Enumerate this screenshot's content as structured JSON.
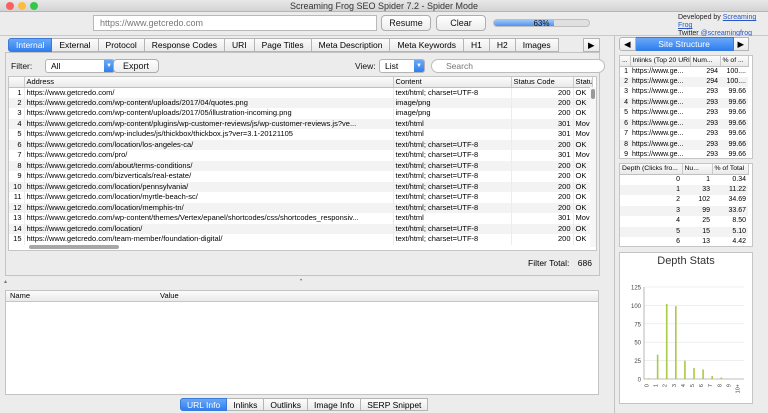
{
  "window": {
    "title": "Screaming Frog SEO Spider 7.2 - Spider Mode"
  },
  "toolbar": {
    "url_value": "https://www.getcredo.com",
    "resume_label": "Resume",
    "clear_label": "Clear",
    "progress_text": "63%",
    "progress_value": 0.63,
    "developed_by": "Developed by",
    "developer_link": "Screaming Frog",
    "twitter": "Twitter",
    "twitter_link": "@screamingfrog"
  },
  "main_tabs": [
    "Internal",
    "External",
    "Protocol",
    "Response Codes",
    "URI",
    "Page Titles",
    "Meta Description",
    "Meta Keywords",
    "H1",
    "H2",
    "Images"
  ],
  "filterbar": {
    "filter_label": "Filter:",
    "filter_value": "All",
    "export_label": "Export",
    "view_label": "View:",
    "view_value": "List",
    "search_placeholder": "Search"
  },
  "grid": {
    "columns": [
      "Address",
      "Content",
      "Status Code",
      "Status"
    ],
    "rows": [
      [
        "1",
        "https://www.getcredo.com/",
        "text/html; charset=UTF-8",
        "200",
        "OK"
      ],
      [
        "2",
        "https://www.getcredo.com/wp-content/uploads/2017/04/quotes.png",
        "image/png",
        "200",
        "OK"
      ],
      [
        "3",
        "https://www.getcredo.com/wp-content/uploads/2017/05/illustration-incoming.png",
        "image/png",
        "200",
        "OK"
      ],
      [
        "4",
        "https://www.getcredo.com/wp-content/plugins/wp-customer-reviews/js/wp-customer-reviews.js?ve...",
        "text/html",
        "301",
        "Mov"
      ],
      [
        "5",
        "https://www.getcredo.com/wp-includes/js/thickbox/thickbox.js?ver=3.1-20121105",
        "text/html",
        "301",
        "Mov"
      ],
      [
        "6",
        "https://www.getcredo.com/location/los-angeles-ca/",
        "text/html; charset=UTF-8",
        "200",
        "OK"
      ],
      [
        "7",
        "https://www.getcredo.com/pro/",
        "text/html; charset=UTF-8",
        "301",
        "Mov"
      ],
      [
        "8",
        "https://www.getcredo.com/about/terms-conditions/",
        "text/html; charset=UTF-8",
        "200",
        "OK"
      ],
      [
        "9",
        "https://www.getcredo.com/bizverticals/real-estate/",
        "text/html; charset=UTF-8",
        "200",
        "OK"
      ],
      [
        "10",
        "https://www.getcredo.com/location/pennsylvania/",
        "text/html; charset=UTF-8",
        "200",
        "OK"
      ],
      [
        "11",
        "https://www.getcredo.com/location/myrtle-beach-sc/",
        "text/html; charset=UTF-8",
        "200",
        "OK"
      ],
      [
        "12",
        "https://www.getcredo.com/location/memphis-tn/",
        "text/html; charset=UTF-8",
        "200",
        "OK"
      ],
      [
        "13",
        "https://www.getcredo.com/wp-content/themes/Vertex/epanel/shortcodes/css/shortcodes_responsiv...",
        "text/html",
        "301",
        "Mov"
      ],
      [
        "14",
        "https://www.getcredo.com/location/",
        "text/html; charset=UTF-8",
        "200",
        "OK"
      ],
      [
        "15",
        "https://www.getcredo.com/team-member/foundation-digital/",
        "text/html; charset=UTF-8",
        "200",
        "OK"
      ]
    ]
  },
  "filter_total": {
    "label": "Filter Total:",
    "value": "686"
  },
  "detail": {
    "col_name": "Name",
    "col_value": "Value"
  },
  "bottom_tabs": [
    "URL Info",
    "Inlinks",
    "Outlinks",
    "Image Info",
    "SERP Snippet"
  ],
  "right": {
    "site_structure_label": "Site Structure",
    "inlinks_table": {
      "columns": [
        "...",
        "Inlinks (Top 20 URI)",
        "Num...",
        "% of ..."
      ],
      "rows": [
        [
          "1",
          "https://www.ge...",
          "294",
          "100...."
        ],
        [
          "2",
          "https://www.ge...",
          "294",
          "100...."
        ],
        [
          "3",
          "https://www.ge...",
          "293",
          "99.66"
        ],
        [
          "4",
          "https://www.ge...",
          "293",
          "99.66"
        ],
        [
          "5",
          "https://www.ge...",
          "293",
          "99.66"
        ],
        [
          "6",
          "https://www.ge...",
          "293",
          "99.66"
        ],
        [
          "7",
          "https://www.ge...",
          "293",
          "99.66"
        ],
        [
          "8",
          "https://www.ge...",
          "293",
          "99.66"
        ],
        [
          "9",
          "https://www.ge...",
          "293",
          "99.66"
        ]
      ]
    },
    "depth_table": {
      "columns": [
        "Depth (Clicks fro...",
        "Nu...",
        "% of Total"
      ],
      "rows": [
        [
          "0",
          "1",
          "0.34"
        ],
        [
          "1",
          "33",
          "11.22"
        ],
        [
          "2",
          "102",
          "34.69"
        ],
        [
          "3",
          "99",
          "33.67"
        ],
        [
          "4",
          "25",
          "8.50"
        ],
        [
          "5",
          "15",
          "5.10"
        ],
        [
          "6",
          "13",
          "4.42"
        ]
      ]
    }
  },
  "chart_data": {
    "type": "bar",
    "title": "Depth Stats",
    "categories": [
      "0",
      "1",
      "2",
      "3",
      "4",
      "5",
      "6",
      "7",
      "8",
      "9",
      "10+"
    ],
    "values": [
      1,
      33,
      102,
      99,
      25,
      15,
      13,
      4,
      2,
      0,
      0
    ],
    "ylim": [
      0,
      125
    ],
    "yticks": [
      "0",
      "25",
      "50",
      "75",
      "100",
      "125"
    ],
    "bar_color": "#a9c94a"
  }
}
